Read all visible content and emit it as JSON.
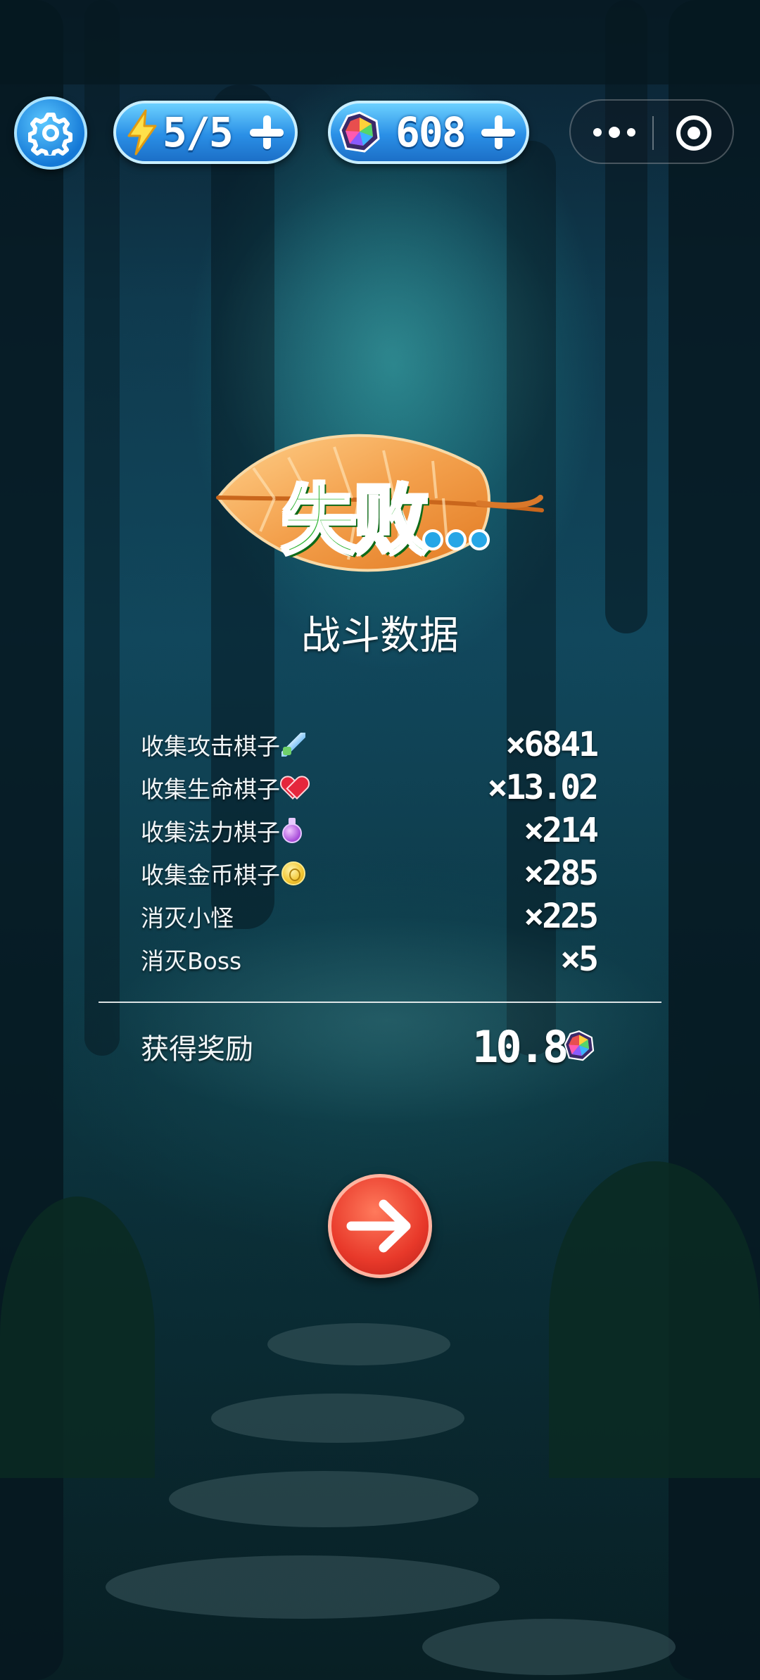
{
  "topbar": {
    "energy": "5/5",
    "gems": "608"
  },
  "result": {
    "title": "失败",
    "section_title": "战斗数据"
  },
  "stats": [
    {
      "label": "收集攻击棋子",
      "icon": "sword-icon",
      "value": "×6841"
    },
    {
      "label": "收集生命棋子",
      "icon": "heart-icon",
      "value": "×13.02"
    },
    {
      "label": "收集法力棋子",
      "icon": "potion-icon",
      "value": "×214"
    },
    {
      "label": "收集金币棋子",
      "icon": "coin-icon",
      "value": "×285"
    },
    {
      "label": "消灭小怪",
      "icon": "",
      "value": "×225"
    },
    {
      "label": "消灭Boss",
      "icon": "",
      "value": "×5"
    }
  ],
  "reward": {
    "label": "获得奖励",
    "value": "10.8",
    "icon": "gem-icon"
  },
  "colors": {
    "pill_blue": "#2a8fe6",
    "fail_green": "#2fb534",
    "leaf_orange": "#f0a04a",
    "next_red": "#e8392a"
  }
}
